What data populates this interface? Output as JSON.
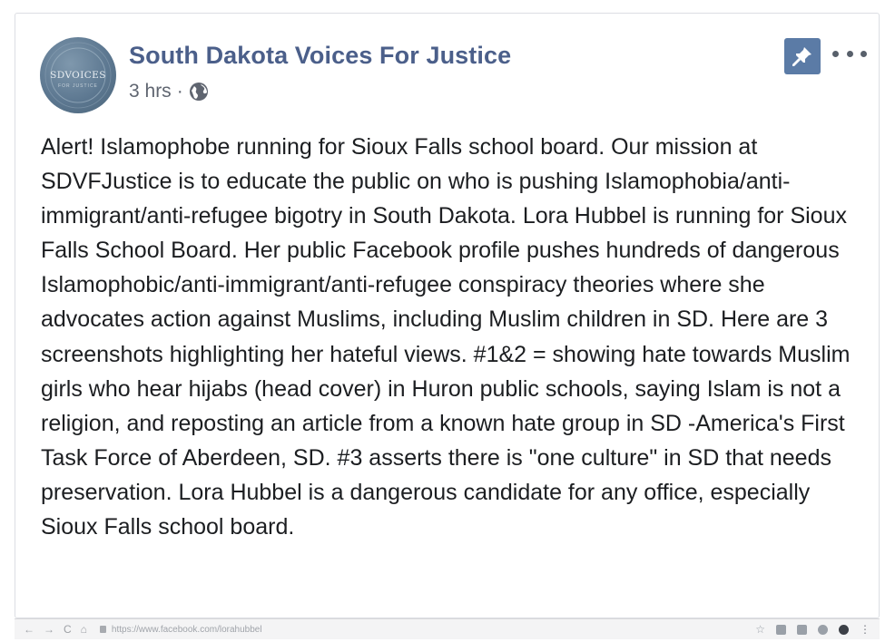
{
  "post": {
    "page_name": "South Dakota Voices For Justice",
    "time": "3 hrs",
    "separator": "·",
    "privacy_icon": "globe-icon",
    "avatar": {
      "text": "SDVOICES",
      "subtext": "FOR JUSTICE"
    },
    "pin_icon": "pushpin-icon",
    "more_icon": "more-options-icon",
    "text": "Alert! Islamophobe running for Sioux Falls school board. Our mission at SDVFJustice is to educate the public on who is pushing Islamophobia/anti-immigrant/anti-refugee bigotry in South Dakota. Lora Hubbel is running for Sioux Falls School Board. Her public Facebook profile pushes hundreds of dangerous Islamophobic/anti-immigrant/anti-refugee conspiracy theories where she advocates action against Muslims, including Muslim children in SD. Here are 3 screenshots highlighting her hateful views. #1&2 = showing hate towards Muslim girls who hear hijabs (head cover) in Huron public schools, saying Islam is not a religion, and reposting an article from a known hate group in SD -America's First Task Force of Aberdeen, SD. #3 asserts there is \"one culture\" in SD that needs preservation. Lora Hubbel is a dangerous candidate for any office, especially Sioux Falls school board."
  },
  "browser": {
    "url": "https://www.facebook.com/lorahubbel",
    "nav": {
      "back": "←",
      "forward": "→",
      "reload": "C",
      "home": "⌂"
    }
  },
  "colors": {
    "page_name": "#4b5f8a",
    "pin_button": "#5b7ba6",
    "text": "#1c1e21"
  }
}
